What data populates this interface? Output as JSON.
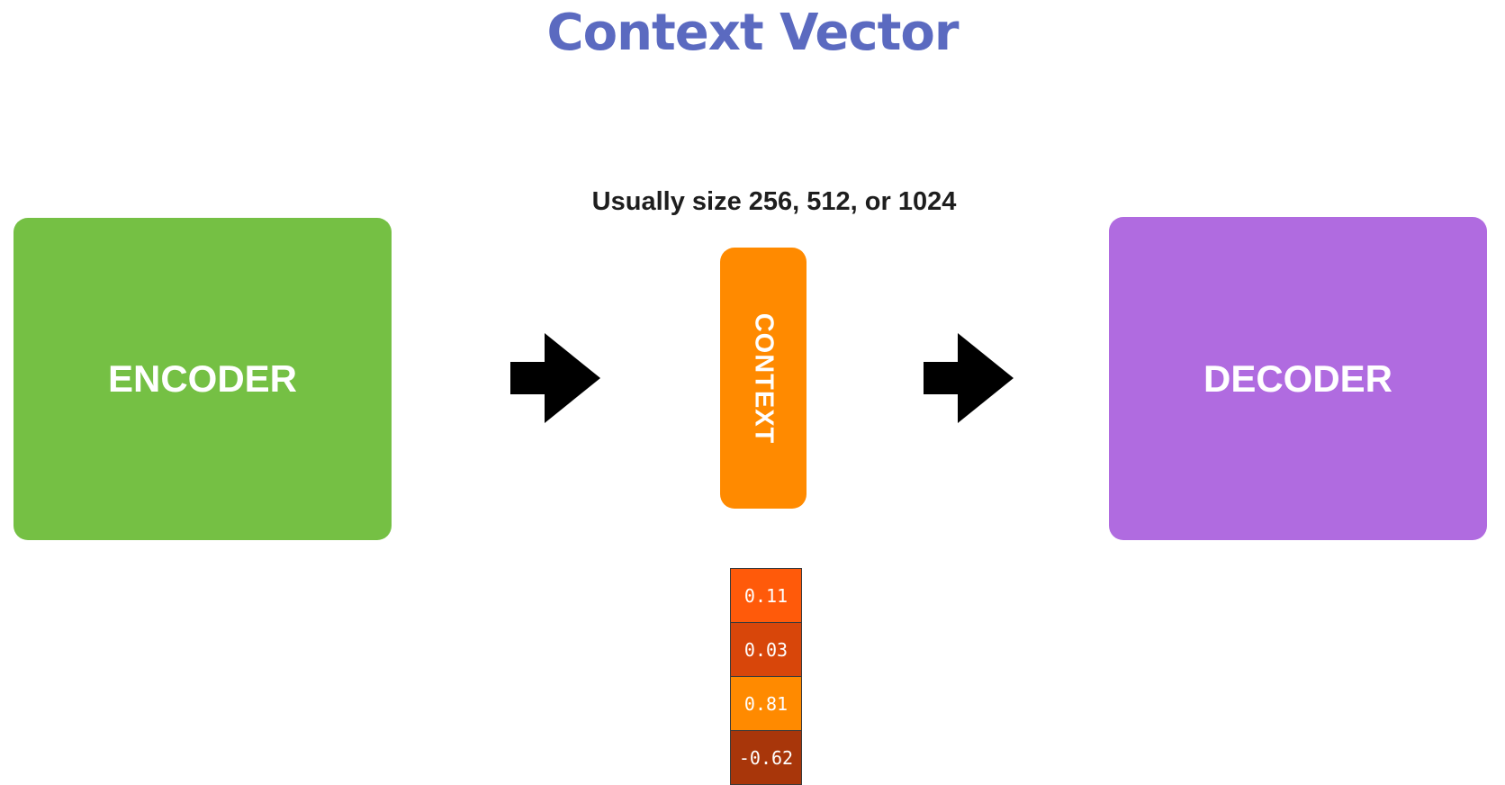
{
  "title": "Context Vector",
  "subtitle": "Usually size 256, 512, or 1024",
  "encoder": {
    "label": "ENCODER",
    "color": "#75c044"
  },
  "context": {
    "label": "CONTEXT",
    "color": "#ff8a00"
  },
  "decoder": {
    "label": "DECODER",
    "color": "#b06be0"
  },
  "vector": {
    "cells": [
      {
        "value": "0.11",
        "color": "#ff5a0a"
      },
      {
        "value": "0.03",
        "color": "#d8460a"
      },
      {
        "value": "0.81",
        "color": "#ff8a00"
      },
      {
        "value": "-0.62",
        "color": "#a8360a"
      }
    ]
  }
}
